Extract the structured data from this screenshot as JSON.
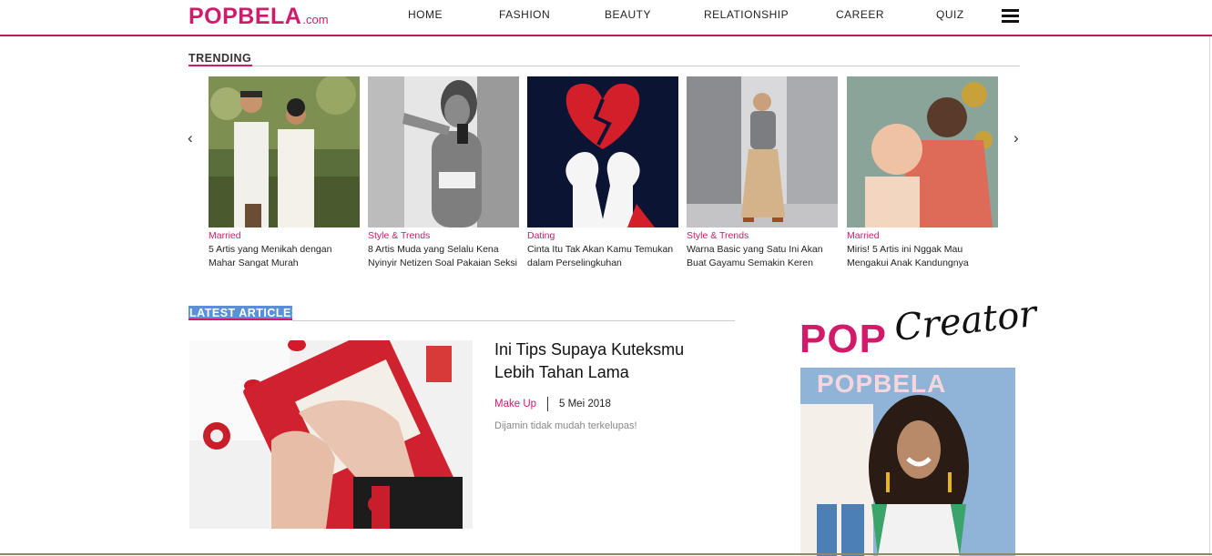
{
  "header": {
    "logo_main": "POPBELA",
    "logo_suffix": ".com",
    "nav": [
      "HOME",
      "FASHION",
      "BEAUTY",
      "RELATIONSHIP",
      "CAREER",
      "QUIZ"
    ],
    "menu_icon": "hamburger-menu-icon"
  },
  "colors": {
    "brand": "#d11a6a",
    "highlight": "#5b8fd6"
  },
  "trending": {
    "title": "TRENDING",
    "prev_icon": "chevron-left-icon",
    "next_icon": "chevron-right-icon",
    "items": [
      {
        "category": "Married",
        "title": "5 Artis yang Menikah dengan Mahar Sangat Murah"
      },
      {
        "category": "Style & Trends",
        "title": "8 Artis Muda yang Selalu Kena Nyinyir Netizen Soal Pakaian Seksi"
      },
      {
        "category": "Dating",
        "title": "Cinta Itu Tak Akan Kamu Temukan dalam Perselingkuhan"
      },
      {
        "category": "Style & Trends",
        "title": "Warna Basic yang Satu Ini Akan Buat Gayamu Semakin Keren"
      },
      {
        "category": "Married",
        "title": "Miris! 5 Artis ini Nggak Mau Mengakui Anak Kandungnya"
      }
    ]
  },
  "latest": {
    "title": "LATEST ARTICLES",
    "article": {
      "title": "Ini Tips Supaya Kuteksmu Lebih Tahan Lama",
      "category": "Make Up",
      "date": "5 Mei 2018",
      "description": "Dijamin tidak mudah terkelupas!"
    }
  },
  "sidebar": {
    "pop": "POP",
    "creator": "Creator",
    "magazine_title": "POPBELA"
  }
}
